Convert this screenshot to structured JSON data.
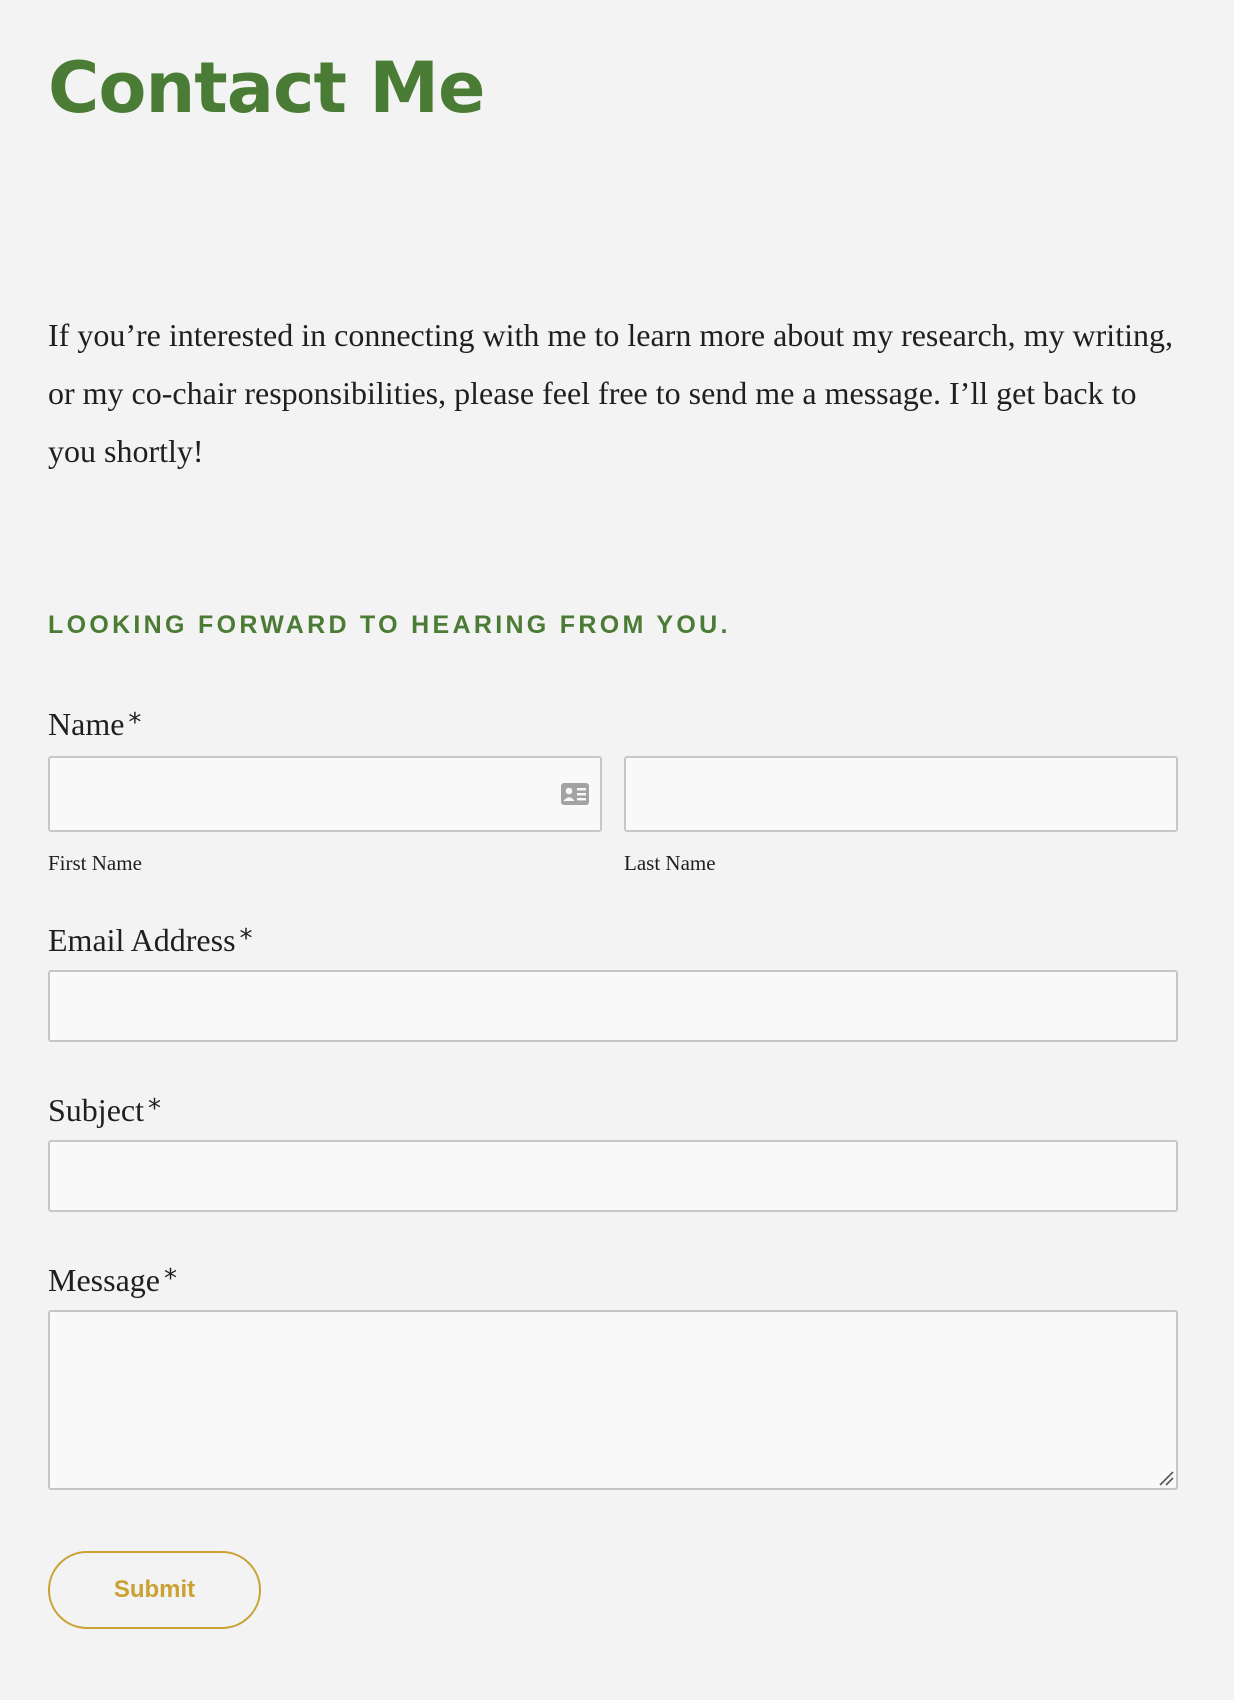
{
  "page": {
    "title": "Contact Me",
    "intro": "If you’re interested in connecting with me to learn more about my research, my writing, or my co-chair responsibilities, please feel free to send me a message.  I’ll get back to you shortly!",
    "subheading": "LOOKING FORWARD TO HEARING FROM YOU."
  },
  "form": {
    "required_marker": "*",
    "name": {
      "label": "Name",
      "first_name_label": "First Name",
      "first_name_value": "",
      "last_name_label": "Last Name",
      "last_name_value": "",
      "first_name_icon": "contact-card-icon"
    },
    "email": {
      "label": "Email Address",
      "value": ""
    },
    "subject": {
      "label": "Subject",
      "value": ""
    },
    "message": {
      "label": "Message",
      "value": "",
      "resize_icon": "resize-handle-icon"
    },
    "submit_label": "Submit"
  },
  "colors": {
    "background": "#f3f3f3",
    "heading_green": "#4a7c35",
    "submit_gold": "#c9a233",
    "input_border": "#c6c6c6",
    "input_fill": "#f9f9f9"
  }
}
